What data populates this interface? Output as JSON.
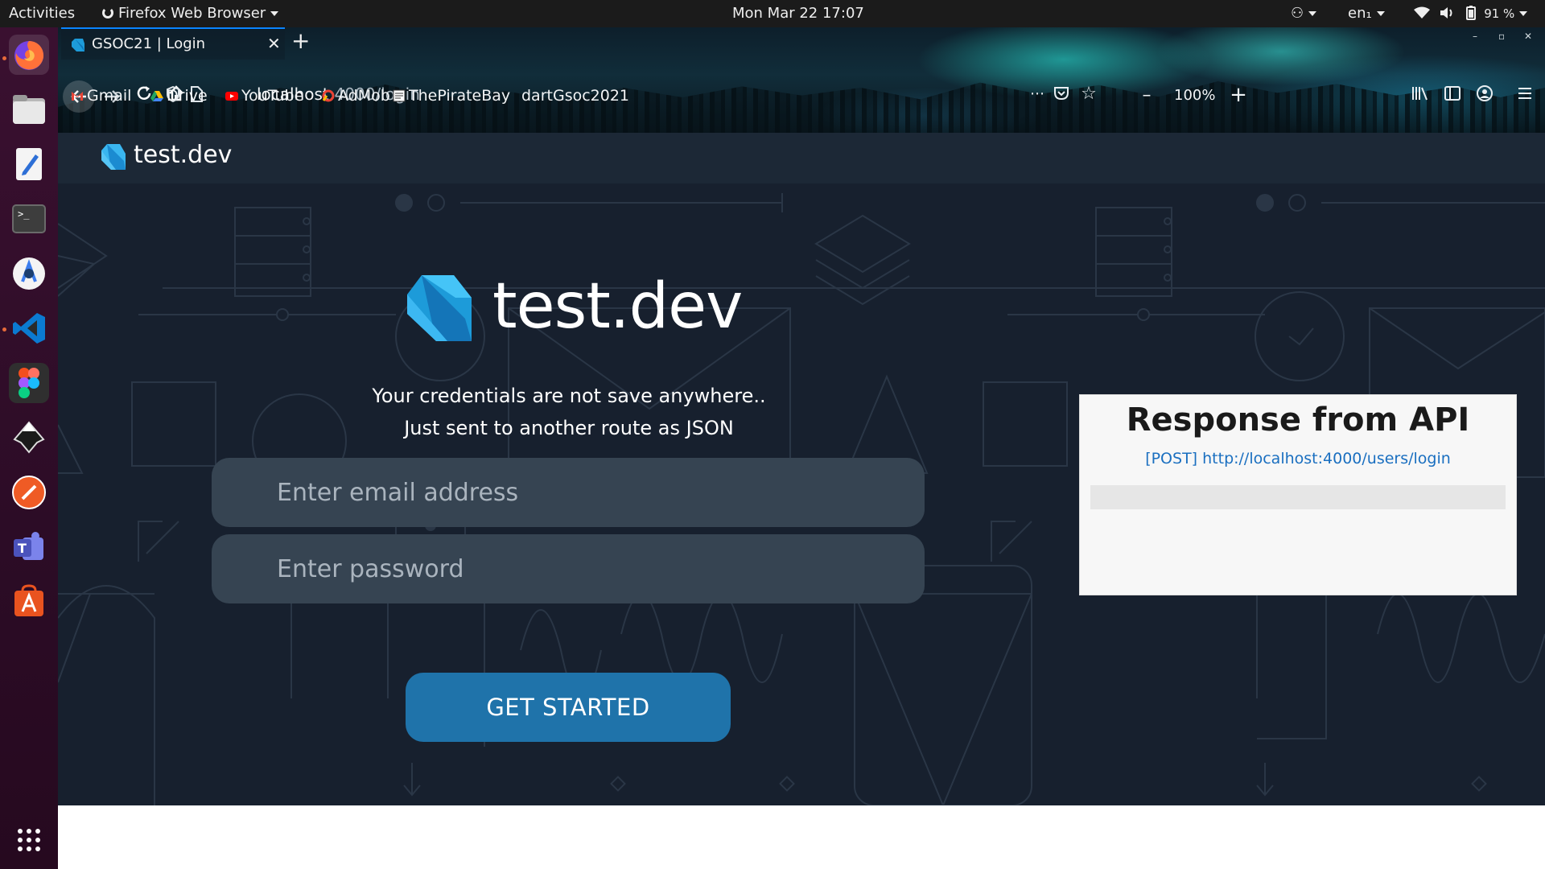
{
  "topbar": {
    "activities": "Activities",
    "app_name": "Firefox Web Browser",
    "clock": "Mon Mar 22  17:07",
    "keyboard": "en₁",
    "battery": "91 %"
  },
  "dock": {
    "items": [
      "firefox-icon",
      "files-icon",
      "text-editor-icon",
      "terminal-icon",
      "android-studio-icon",
      "vscode-icon",
      "figma-icon",
      "inkscape-icon",
      "postman-icon",
      "teams-icon",
      "software-center-icon"
    ],
    "show_apps": "show-applications-icon"
  },
  "browser": {
    "tab_title": "GSOC21 | Login",
    "url_host": "localhost",
    "url_path": ":4000/login",
    "zoom": "100%",
    "bookmarks": [
      "Gmail",
      "Drive",
      "YouTube",
      "AdMob",
      "ThePirateBay",
      "dartGsoc2021"
    ]
  },
  "app": {
    "header_title": "test.dev",
    "hero_title": "test.dev",
    "subtitle_line1": "Your credentials are not save anywhere..",
    "subtitle_line2": "Just sent to another route as JSON",
    "email_placeholder": "Enter email address",
    "password_placeholder": "Enter password",
    "cta_label": "GET STARTED"
  },
  "api_panel": {
    "title": "Response from API",
    "endpoint": "[POST] http://localhost:4000/users/login",
    "response_body": ""
  },
  "colors": {
    "header_bg": "#1c2836",
    "main_bg": "#17202e",
    "input_bg": "#364452",
    "button_bg": "#1f73aa",
    "dart_blue": "#1d9bd9"
  }
}
